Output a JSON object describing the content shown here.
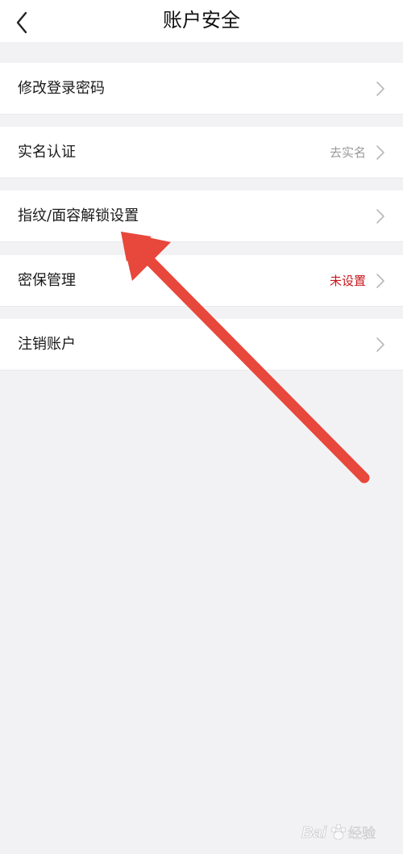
{
  "header": {
    "title": "账户安全"
  },
  "menu": {
    "items": [
      {
        "label": "修改登录密码",
        "value": ""
      },
      {
        "label": "实名认证",
        "value": "去实名"
      },
      {
        "label": "指纹/面容解锁设置",
        "value": ""
      },
      {
        "label": "密保管理",
        "value": "未设置"
      },
      {
        "label": "注销账户",
        "value": ""
      }
    ]
  },
  "colors": {
    "warning_text": "#c8161d",
    "annotation_arrow": "#e8473b"
  },
  "watermark": {
    "text": "Baidu经验"
  }
}
